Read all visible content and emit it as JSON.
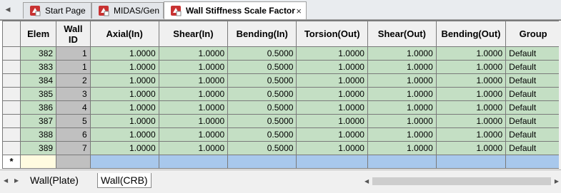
{
  "tabs": [
    {
      "label": "Start Page",
      "icon": "app-icon"
    },
    {
      "label": "MIDAS/Gen",
      "icon": "app-icon"
    },
    {
      "label": "Wall Stiffness Scale Factor",
      "icon": "app-icon",
      "active": true
    }
  ],
  "tab_close_label": "×",
  "grid": {
    "headers": [
      "Elem",
      "Wall\nID",
      "Axial(In)",
      "Shear(In)",
      "Bending(In)",
      "Torsion(Out)",
      "Shear(Out)",
      "Bending(Out)",
      "Group"
    ],
    "rows": [
      [
        "382",
        "1",
        "1.0000",
        "1.0000",
        "0.5000",
        "1.0000",
        "1.0000",
        "1.0000",
        "Default"
      ],
      [
        "383",
        "1",
        "1.0000",
        "1.0000",
        "0.5000",
        "1.0000",
        "1.0000",
        "1.0000",
        "Default"
      ],
      [
        "384",
        "2",
        "1.0000",
        "1.0000",
        "0.5000",
        "1.0000",
        "1.0000",
        "1.0000",
        "Default"
      ],
      [
        "385",
        "3",
        "1.0000",
        "1.0000",
        "0.5000",
        "1.0000",
        "1.0000",
        "1.0000",
        "Default"
      ],
      [
        "386",
        "4",
        "1.0000",
        "1.0000",
        "0.5000",
        "1.0000",
        "1.0000",
        "1.0000",
        "Default"
      ],
      [
        "387",
        "5",
        "1.0000",
        "1.0000",
        "0.5000",
        "1.0000",
        "1.0000",
        "1.0000",
        "Default"
      ],
      [
        "388",
        "6",
        "1.0000",
        "1.0000",
        "0.5000",
        "1.0000",
        "1.0000",
        "1.0000",
        "Default"
      ],
      [
        "389",
        "7",
        "1.0000",
        "1.0000",
        "0.5000",
        "1.0000",
        "1.0000",
        "1.0000",
        "Default"
      ]
    ],
    "new_row_marker": "*"
  },
  "sheets": [
    {
      "label": "Wall(Plate)"
    },
    {
      "label": "Wall(CRB)",
      "active": true
    }
  ],
  "colors": {
    "cell_green": "#c4dfc4",
    "id_gray": "#c0c0c0",
    "new_row_blue": "#a8c8ec"
  }
}
